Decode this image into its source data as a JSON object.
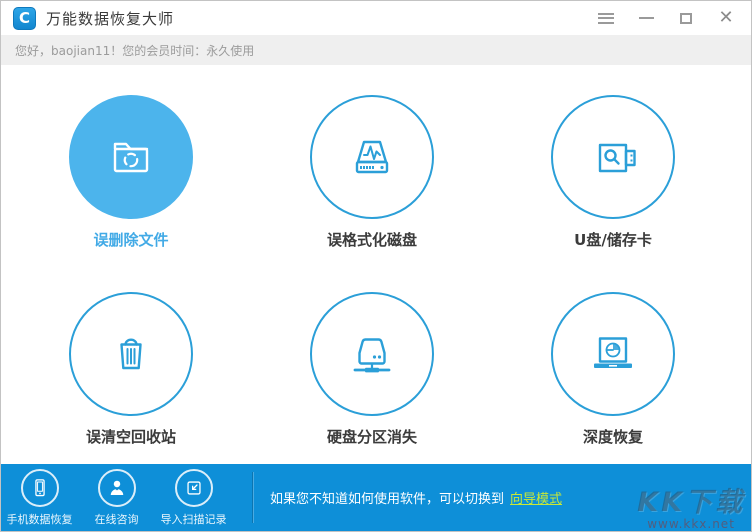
{
  "titlebar": {
    "title": "万能数据恢复大师",
    "logo_letter": "C"
  },
  "memberbar": {
    "greeting": "您好，baojian11！您的会员时间：永久使用"
  },
  "features": [
    {
      "label": "误删除文件",
      "icon": "folder-recycle-icon",
      "active": true
    },
    {
      "label": "误格式化磁盘",
      "icon": "format-disk-icon",
      "active": false
    },
    {
      "label": "U盘/储存卡",
      "icon": "usb-storage-icon",
      "active": false
    },
    {
      "label": "误清空回收站",
      "icon": "recycle-bin-icon",
      "active": false
    },
    {
      "label": "硬盘分区消失",
      "icon": "partition-lost-icon",
      "active": false
    },
    {
      "label": "深度恢复",
      "icon": "deep-recovery-icon",
      "active": false
    }
  ],
  "bottombar": {
    "tools": [
      {
        "label": "手机数据恢复",
        "icon": "phone-icon"
      },
      {
        "label": "在线咨询",
        "icon": "person-icon"
      },
      {
        "label": "导入扫描记录",
        "icon": "import-record-icon"
      }
    ],
    "hint_text": "如果您不知道如何使用软件，可以切换到",
    "hint_link_label": "向导模式"
  },
  "watermark": {
    "line1": "KK下载",
    "line2": "www.kkx.net"
  },
  "colors": {
    "accent_blue": "#2b9fd8",
    "active_circle_fill": "#4cb4ec",
    "bottom_bar_blue": "#0e8fd8",
    "link_green": "#c8e837",
    "member_bar_gray": "#efefef"
  }
}
